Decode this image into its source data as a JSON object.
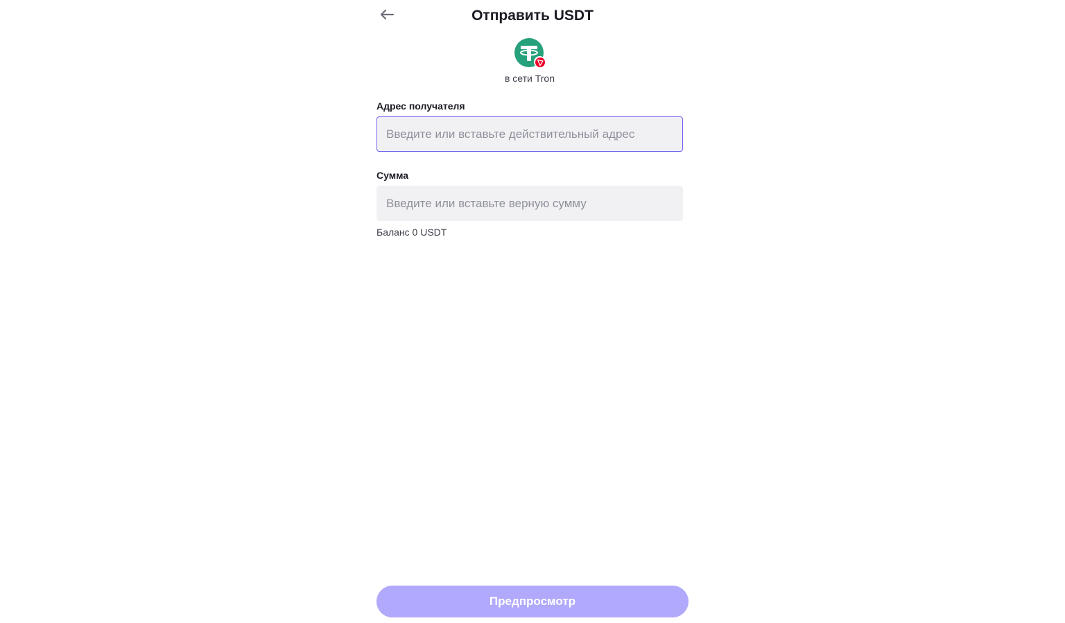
{
  "header": {
    "title": "Отправить USDT",
    "back_icon": "arrow-left-icon"
  },
  "asset": {
    "coin_icon": "tether-usdt-icon",
    "network_icon": "tron-icon",
    "network_label": "в сети Tron"
  },
  "form": {
    "recipient": {
      "label": "Адрес получателя",
      "value": "",
      "placeholder": "Введите или вставьте действительный адрес"
    },
    "amount": {
      "label": "Сумма",
      "value": "",
      "placeholder": "Введите или вставьте верную сумму"
    },
    "balance": "Баланс 0 USDT"
  },
  "actions": {
    "preview_label": "Предпросмотр"
  },
  "colors": {
    "accent": "#6e60ee",
    "button_disabled": "#b1a9fb",
    "usdt_green": "#26a17b",
    "tron_red": "#eb0029",
    "input_bg": "#f1f1f3"
  }
}
